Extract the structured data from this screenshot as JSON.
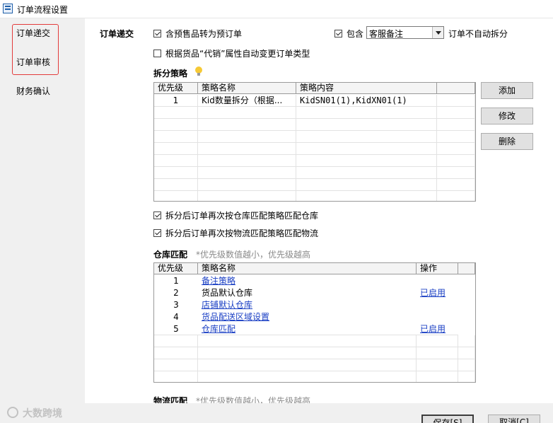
{
  "window": {
    "title": "订单流程设置"
  },
  "sidebar": {
    "items": [
      {
        "label": "订单递交"
      },
      {
        "label": "订单审核"
      },
      {
        "label": "财务确认"
      }
    ]
  },
  "submit": {
    "section_label": "订单递交",
    "presale_to_preorder": {
      "label": "含预售品转为预订单",
      "checked": true
    },
    "include": {
      "label": "包含",
      "checked": true
    },
    "include_select": {
      "value": "客服备注"
    },
    "no_auto_split_label": "订单不自动拆分",
    "consign_type_change": {
      "label": "根据货品“代销”属性自动变更订单类型",
      "checked": false
    }
  },
  "split": {
    "title": "拆分策略",
    "columns": [
      "优先级",
      "策略名称",
      "策略内容"
    ],
    "rows": [
      {
        "priority": "1",
        "name": "Kid数量拆分（根据...",
        "content": "KidSN01(1),KidXN01(1)"
      }
    ],
    "buttons": {
      "add": "添加",
      "edit": "修改",
      "delete": "删除"
    }
  },
  "after_split": {
    "warehouse": {
      "label": "拆分后订单再次按仓库匹配策略匹配仓库",
      "checked": true
    },
    "logistics": {
      "label": "拆分后订单再次按物流匹配策略匹配物流",
      "checked": true
    }
  },
  "warehouse_match": {
    "title": "仓库匹配",
    "hint": "*优先级数值越小，优先级越高",
    "columns": [
      "优先级",
      "策略名称",
      "操作"
    ],
    "rows": [
      {
        "priority": "1",
        "name": "备注策略",
        "name_link": true,
        "action": ""
      },
      {
        "priority": "2",
        "name": "货品默认仓库",
        "name_link": false,
        "action": "已启用"
      },
      {
        "priority": "3",
        "name": "店铺默认仓库",
        "name_link": true,
        "action": ""
      },
      {
        "priority": "4",
        "name": "货品配送区域设置",
        "name_link": true,
        "action": ""
      },
      {
        "priority": "5",
        "name": "仓库匹配",
        "name_link": true,
        "action": "已启用"
      }
    ]
  },
  "logistics_match": {
    "title": "物流匹配",
    "hint": "*优先级数值越小，优先级越高"
  },
  "footer": {
    "watermark": "大数跨境",
    "save": "保存[S]",
    "cancel": "取消[C]"
  },
  "colors": {
    "link": "#1a3fc4",
    "highlight_border": "#e33b3b",
    "hint": "#8a8a8a"
  }
}
